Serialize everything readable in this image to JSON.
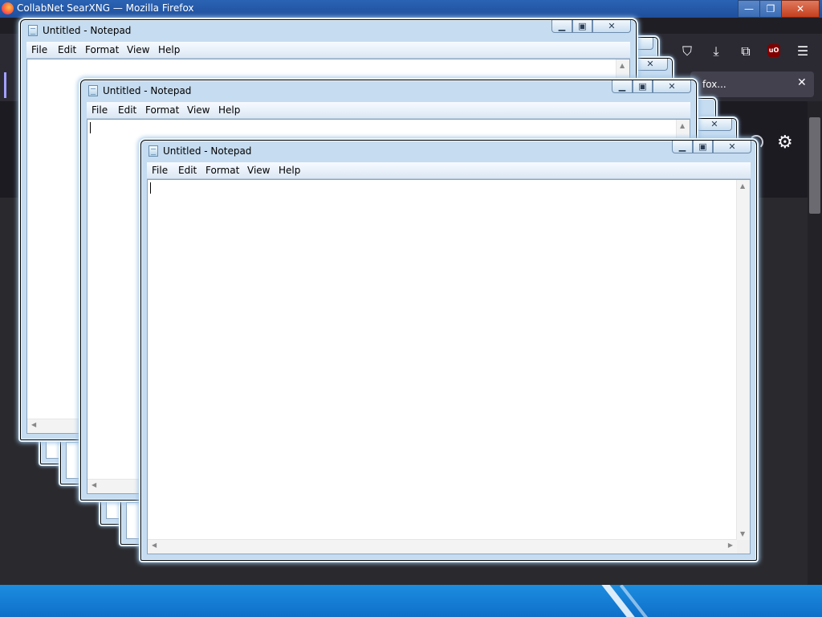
{
  "browser": {
    "window_title": "CollabNet SearXNG — Mozilla Firefox",
    "tab_label": "fox...",
    "tab_close": "✕",
    "controls": {
      "minimize": "—",
      "maximize": "❐",
      "close": "✕"
    },
    "toolbar_icons": {
      "pocket": "⛉",
      "downloads": "⤓",
      "extensions": "⧉",
      "ublock": "uO",
      "menu": "☰"
    },
    "settings_icon": "⚙"
  },
  "notepad": {
    "title": "Untitled - Notepad",
    "menu": [
      "File",
      "Edit",
      "Format",
      "View",
      "Help"
    ],
    "controls": {
      "minimize": "▁",
      "maximize": "▣",
      "close": "✕"
    },
    "text": ""
  },
  "colors": {
    "desktop_blue": "#1c8de0",
    "firefox_dark": "#2b2a33",
    "aero_frame": "#c6dcf0"
  }
}
